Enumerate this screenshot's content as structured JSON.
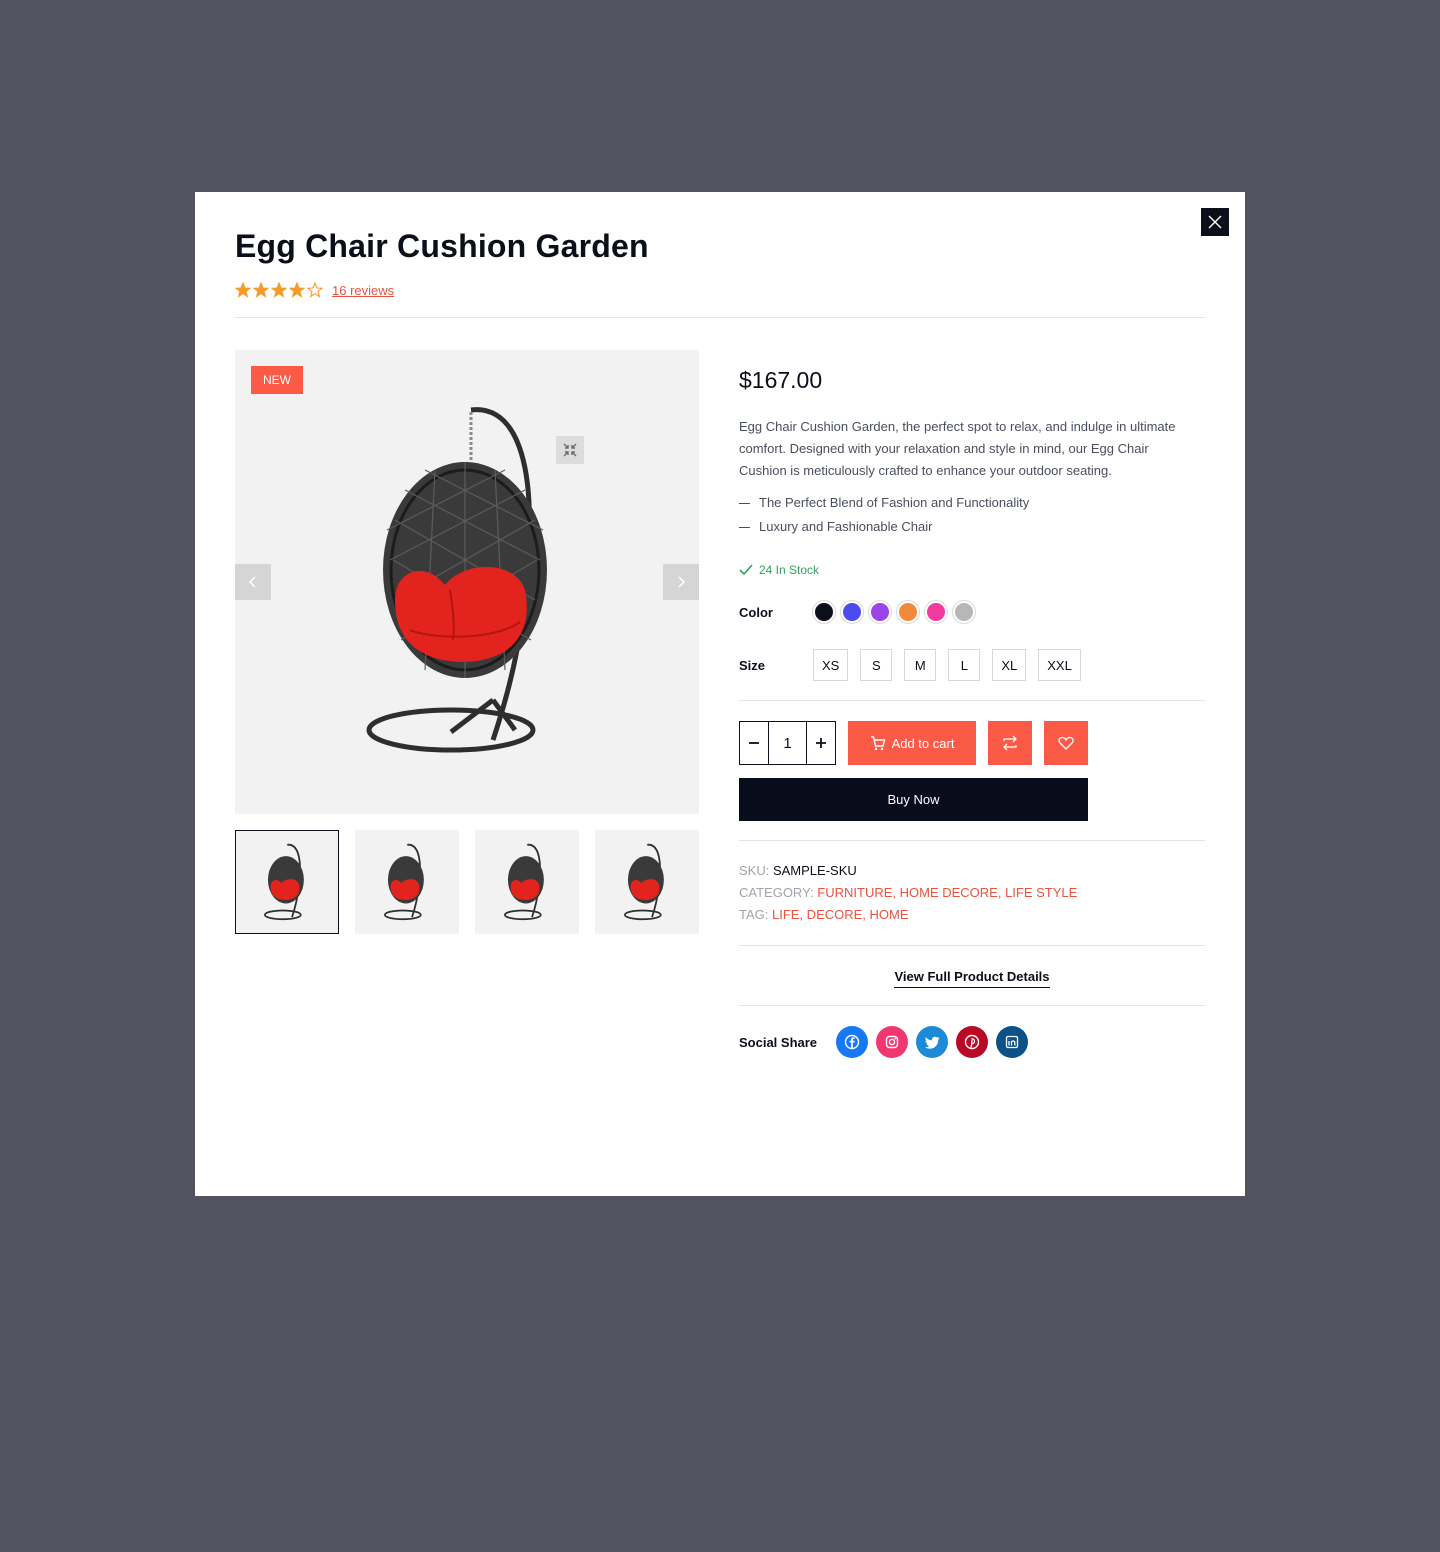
{
  "product": {
    "title": "Egg Chair Cushion Garden",
    "rating": 4,
    "rating_max": 5,
    "reviews_label": "16 reviews",
    "badge": "NEW",
    "price": "$167.00",
    "description": "Egg Chair Cushion Garden, the perfect spot to relax, and indulge in ultimate comfort. Designed with your relaxation and style in mind, our Egg Chair Cushion is meticulously crafted to enhance your outdoor seating.",
    "features": [
      "The Perfect Blend of Fashion and Functionality",
      "Luxury and Fashionable Chair"
    ],
    "stock": "24 In Stock"
  },
  "options": {
    "color_label": "Color",
    "colors": [
      "#0b0f1a",
      "#4b4bf0",
      "#9b45e6",
      "#f28a3c",
      "#f03ba0",
      "#b7b7b7"
    ],
    "size_label": "Size",
    "sizes": [
      "XS",
      "S",
      "M",
      "L",
      "XL",
      "XXL"
    ]
  },
  "cart": {
    "quantity": "1",
    "add_to_cart": "Add to cart",
    "buy_now": "Buy Now"
  },
  "meta": {
    "sku_label": "SKU:",
    "sku": "SAMPLE-SKU",
    "category_label": "CATEGORY:",
    "categories": "FURNITURE, HOME DECORE, LIFE STYLE",
    "tag_label": "TAG:",
    "tags": "LIFE, DECORE, HOME"
  },
  "links": {
    "view_details": "View Full Product Details"
  },
  "social": {
    "label": "Social Share",
    "networks": [
      {
        "name": "facebook-icon",
        "color": "#1877f2"
      },
      {
        "name": "instagram-icon",
        "color": "#f23670"
      },
      {
        "name": "twitter-icon",
        "color": "#1c8ad6"
      },
      {
        "name": "pinterest-icon",
        "color": "#b80a24"
      },
      {
        "name": "linkedin-icon",
        "color": "#0c5288"
      }
    ]
  },
  "gallery": {
    "thumbnail_count": 4,
    "active_thumbnail": 0
  },
  "colors": {
    "accent": "#fa5a46",
    "dark": "#070d1a",
    "stock": "#2da35f",
    "star": "#f39c2c",
    "overlay": "#52535f"
  }
}
